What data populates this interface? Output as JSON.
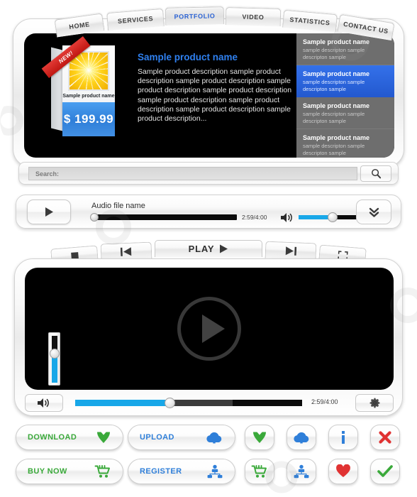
{
  "nav": {
    "tabs": [
      {
        "label": "HOME",
        "active": false
      },
      {
        "label": "SERVICES",
        "active": false
      },
      {
        "label": "PORTFOLIO",
        "active": true
      },
      {
        "label": "VIDEO",
        "active": false
      },
      {
        "label": "STATISTICS",
        "active": false
      },
      {
        "label": "CONTACT US",
        "active": false
      }
    ],
    "active_color": "#2b63d4"
  },
  "product": {
    "ribbon": "NEW!",
    "box_caption": "Sample product name",
    "price": "$ 199.99",
    "title": "Sample product name",
    "title_color": "#2f80ef",
    "description": "Sample product description sample product description sample product description sample product description sample product description sample product description sample product description sample product description sample product description..."
  },
  "product_list": {
    "selected_index": 1,
    "selected_color": "#2f6ce0",
    "items": [
      {
        "title": "Sample product name",
        "desc": "sample descripton sample descripton sample"
      },
      {
        "title": "Sample product name",
        "desc": "sample descripton sample descripton sample"
      },
      {
        "title": "Sample product name",
        "desc": "sample descripton sample descripton sample"
      },
      {
        "title": "Sample product name",
        "desc": "sample descripton sample descripton sample"
      }
    ]
  },
  "search": {
    "label": "Search:",
    "value": "",
    "placeholder": "Search:",
    "button_icon": "search-icon"
  },
  "audio_player": {
    "play_icon": "play-icon",
    "file_name": "Audio file name",
    "time": "2:59/4:00",
    "progress_percent": 2,
    "volume_icon": "volume-icon",
    "volume_percent": 50,
    "expand_icon": "double-chevron-down-icon"
  },
  "video_toolbar": {
    "stop_icon": "stop-icon",
    "prev_icon": "previous-track-icon",
    "play_label": "PLAY",
    "play_icon": "play-icon",
    "next_icon": "next-track-icon",
    "fullscreen_icon": "fullscreen-icon"
  },
  "video_player": {
    "overlay_icon": "big-play-icon",
    "vertical_slider_percent": 55,
    "mute_icon": "volume-icon",
    "settings_icon": "gear-icon",
    "time": "2:59/4:00",
    "progress_percent": 41,
    "buffer_percent": 69,
    "accent_color": "#18a7e8"
  },
  "bottom_buttons": {
    "pills": [
      {
        "label": "DOWNLOAD",
        "icon": "download-heart-icon",
        "color": "green"
      },
      {
        "label": "UPLOAD",
        "icon": "upload-cloud-icon",
        "color": "blue"
      },
      {
        "label": "BUY NOW",
        "icon": "shopping-cart-icon",
        "color": "green"
      },
      {
        "label": "REGISTER",
        "icon": "group-users-icon",
        "color": "blue"
      }
    ],
    "icon_buttons": [
      {
        "icon": "download-heart-icon",
        "color": "#3aa93a"
      },
      {
        "icon": "upload-cloud-icon",
        "color": "#2f7fd9"
      },
      {
        "icon": "info-icon",
        "color": "#2f7fd9"
      },
      {
        "icon": "close-x-icon",
        "color": "#e03232"
      },
      {
        "icon": "shopping-cart-icon",
        "color": "#3aa93a"
      },
      {
        "icon": "group-users-icon",
        "color": "#2f7fd9"
      },
      {
        "icon": "heart-icon",
        "color": "#e03232"
      },
      {
        "icon": "check-icon",
        "color": "#3aa93a"
      }
    ]
  },
  "colors": {
    "green": "#3aa93a",
    "blue": "#2f7fd9",
    "red": "#e03232",
    "accent_cyan": "#18a7e8"
  }
}
